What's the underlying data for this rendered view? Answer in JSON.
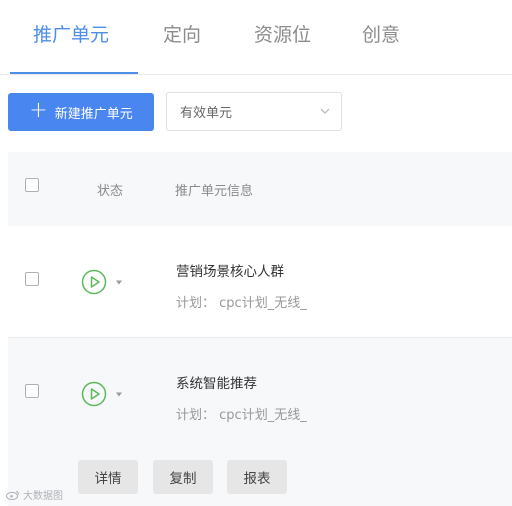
{
  "tabs": [
    "推广单元",
    "定向",
    "资源位",
    "创意"
  ],
  "toolbar": {
    "new_button_label": "新建推广单元",
    "filter_value": "有效单元"
  },
  "table": {
    "headers": {
      "status": "状态",
      "info": "推广单元信息"
    },
    "rows": [
      {
        "name": "营销场景核心人群",
        "plan_label": "计划：",
        "plan_value": "cpc计划_无线_"
      },
      {
        "name": "系统智能推荐",
        "plan_label": "计划：",
        "plan_value": "cpc计划_无线_"
      }
    ]
  },
  "row_actions": [
    "详情",
    "复制",
    "报表"
  ],
  "watermark": "大数据图",
  "colors": {
    "accent": "#4a86f0",
    "status_green": "#5cb85c"
  }
}
